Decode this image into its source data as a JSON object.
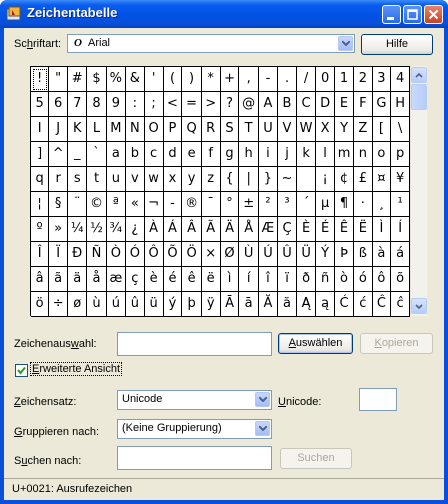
{
  "window": {
    "title": "Zeichentabelle"
  },
  "font_row": {
    "label_prefix": "Sc",
    "label_underlined": "h",
    "label_suffix": "riftart:",
    "font_icon": "O",
    "font_name": "Arial",
    "help_button": "Hilfe"
  },
  "characters": [
    [
      "!",
      "\"",
      "#",
      "$",
      "%",
      "&",
      "'",
      "(",
      ")",
      "*",
      "+",
      ",",
      "-",
      ".",
      "/",
      "0",
      "1",
      "2",
      "3",
      "4"
    ],
    [
      "5",
      "6",
      "7",
      "8",
      "9",
      ":",
      ";",
      "<",
      "=",
      ">",
      "?",
      "@",
      "A",
      "B",
      "C",
      "D",
      "E",
      "F",
      "G",
      "H"
    ],
    [
      "I",
      "J",
      "K",
      "L",
      "M",
      "N",
      "O",
      "P",
      "Q",
      "R",
      "S",
      "T",
      "U",
      "V",
      "W",
      "X",
      "Y",
      "Z",
      "[",
      "\\"
    ],
    [
      "]",
      "^",
      "_",
      "`",
      "a",
      "b",
      "c",
      "d",
      "e",
      "f",
      "g",
      "h",
      "i",
      "j",
      "k",
      "l",
      "m",
      "n",
      "o",
      "p"
    ],
    [
      "q",
      "r",
      "s",
      "t",
      "u",
      "v",
      "w",
      "x",
      "y",
      "z",
      "{",
      "|",
      "}",
      "~",
      " ",
      "¡",
      "¢",
      "£",
      "¤",
      "¥"
    ],
    [
      "¦",
      "§",
      "¨",
      "©",
      "ª",
      "«",
      "¬",
      "-",
      "®",
      "¯",
      "°",
      "±",
      "²",
      "³",
      "´",
      "µ",
      "¶",
      "·",
      "¸",
      "¹"
    ],
    [
      "º",
      "»",
      "¼",
      "½",
      "¾",
      "¿",
      "À",
      "Á",
      "Â",
      "Ã",
      "Ä",
      "Å",
      "Æ",
      "Ç",
      "È",
      "É",
      "Ê",
      "Ë",
      "Ì",
      "Í"
    ],
    [
      "Î",
      "Ï",
      "Ð",
      "Ñ",
      "Ò",
      "Ó",
      "Ô",
      "Õ",
      "Ö",
      "×",
      "Ø",
      "Ù",
      "Ú",
      "Û",
      "Ü",
      "Ý",
      "Þ",
      "ß",
      "à",
      "á"
    ],
    [
      "â",
      "ã",
      "ä",
      "å",
      "æ",
      "ç",
      "è",
      "é",
      "ê",
      "ë",
      "ì",
      "í",
      "î",
      "ï",
      "ð",
      "ñ",
      "ò",
      "ó",
      "ô",
      "õ"
    ],
    [
      "ö",
      "÷",
      "ø",
      "ù",
      "ú",
      "û",
      "ü",
      "ý",
      "þ",
      "ÿ",
      "Ā",
      "ā",
      "Ă",
      "ă",
      "Ą",
      "ą",
      "Ć",
      "ć",
      "Ĉ",
      "ĉ"
    ]
  ],
  "selection_row": {
    "label_prefix": "Zeichenaus",
    "label_underlined": "w",
    "label_suffix": "ahl:",
    "value": "",
    "select_button_prefix": "",
    "select_button_underlined": "A",
    "select_button_suffix": "uswählen",
    "copy_button_prefix": "",
    "copy_button_underlined": "K",
    "copy_button_suffix": "opieren"
  },
  "advanced_view": {
    "checked": true,
    "label_prefix": "",
    "label_underlined": "E",
    "label_suffix": "rweiterte Ansicht"
  },
  "charset": {
    "label_prefix": "",
    "label_underlined": "Z",
    "label_suffix": "eichensatz:",
    "value": "Unicode",
    "unicode_label_prefix": "",
    "unicode_label_underlined": "U",
    "unicode_label_suffix": "nicode:",
    "unicode_value": ""
  },
  "group": {
    "label_prefix": "",
    "label_underlined": "G",
    "label_suffix": "ruppieren nach:",
    "value": "(Keine Gruppierung)"
  },
  "search": {
    "label_prefix": "S",
    "label_underlined": "u",
    "label_suffix": "chen nach:",
    "value": "",
    "button": "Suchen"
  },
  "status_bar": {
    "text": "U+0021: Ausrufezeichen"
  },
  "colors": {
    "titlebar": "#0052e4",
    "client": "#ece9d8",
    "accent_border": "#003c74"
  }
}
